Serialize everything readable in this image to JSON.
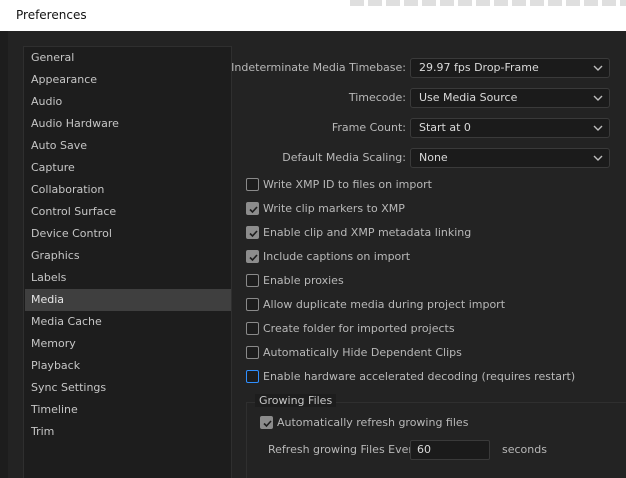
{
  "window": {
    "title": "Preferences"
  },
  "sidebar": {
    "items": [
      {
        "label": "General"
      },
      {
        "label": "Appearance"
      },
      {
        "label": "Audio"
      },
      {
        "label": "Audio Hardware"
      },
      {
        "label": "Auto Save"
      },
      {
        "label": "Capture"
      },
      {
        "label": "Collaboration"
      },
      {
        "label": "Control Surface"
      },
      {
        "label": "Device Control"
      },
      {
        "label": "Graphics"
      },
      {
        "label": "Labels"
      },
      {
        "label": "Media"
      },
      {
        "label": "Media Cache"
      },
      {
        "label": "Memory"
      },
      {
        "label": "Playback"
      },
      {
        "label": "Sync Settings"
      },
      {
        "label": "Timeline"
      },
      {
        "label": "Trim"
      }
    ],
    "selected": "Media"
  },
  "media": {
    "fields": [
      {
        "label": "Indeterminate Media Timebase:",
        "value": "29.97 fps Drop-Frame"
      },
      {
        "label": "Timecode:",
        "value": "Use Media Source"
      },
      {
        "label": "Frame Count:",
        "value": "Start at 0"
      },
      {
        "label": "Default Media Scaling:",
        "value": "None"
      }
    ],
    "checkboxes": [
      {
        "label": "Write XMP ID to files on import",
        "checked": false
      },
      {
        "label": "Write clip markers to XMP",
        "checked": true
      },
      {
        "label": "Enable clip and XMP metadata linking",
        "checked": true
      },
      {
        "label": "Include captions on import",
        "checked": true
      },
      {
        "label": "Enable proxies",
        "checked": false
      },
      {
        "label": "Allow duplicate media during project import",
        "checked": false
      },
      {
        "label": "Create folder for imported projects",
        "checked": false
      },
      {
        "label": "Automatically Hide Dependent Clips",
        "checked": false
      },
      {
        "label": "Enable hardware accelerated decoding (requires restart)",
        "checked": false,
        "focused": true
      }
    ],
    "growing_files": {
      "title": "Growing Files",
      "auto_refresh_label": "Automatically refresh growing files",
      "auto_refresh_checked": true,
      "refresh_label": "Refresh growing Files Every",
      "refresh_value": "60",
      "refresh_unit": "seconds"
    }
  },
  "colors": {
    "background": "#1d1d1d",
    "selected_item": "#3f3f3f",
    "focus_ring": "#2f8fff"
  }
}
